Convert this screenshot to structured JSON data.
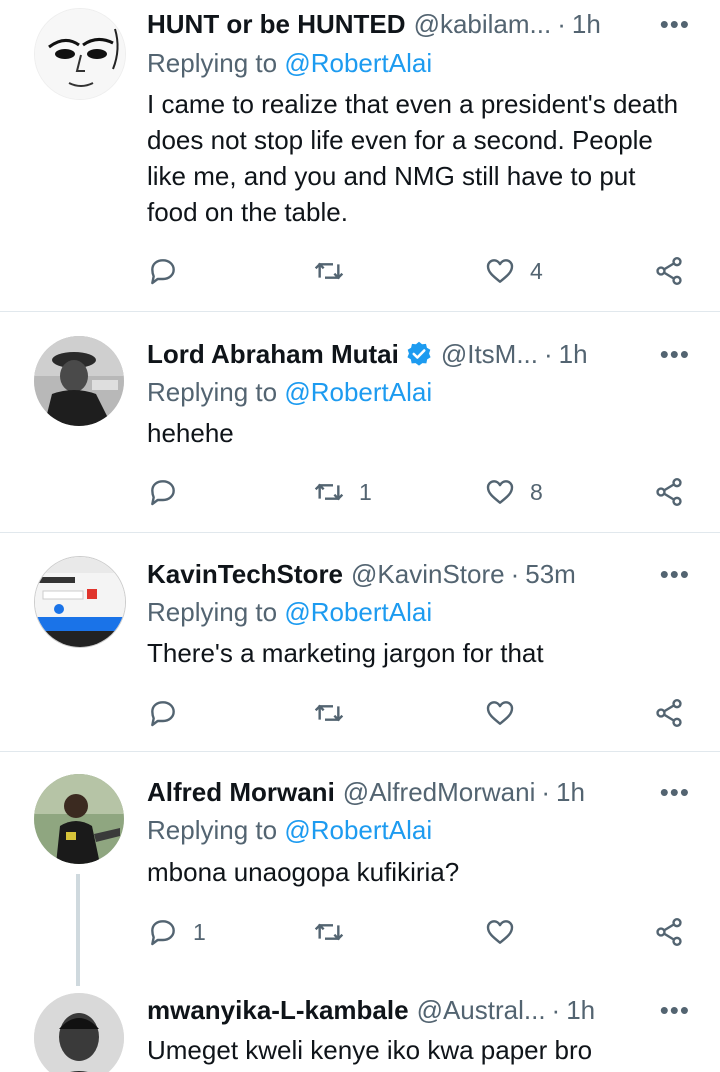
{
  "replying_label": "Replying to",
  "tweets": [
    {
      "name": "HUNT or be HUNTED",
      "handle": "@kabilam...",
      "time": "1h",
      "reply_to": "@RobertAlai",
      "text": "I came to realize that even a president's death does not stop life even for a second. People like me, and you and NMG still have to put food on the table.",
      "replies": "",
      "retweets": "",
      "likes": "4"
    },
    {
      "name": "Lord Abraham Mutai",
      "handle": "@ItsM...",
      "time": "1h",
      "verified": true,
      "reply_to": "@RobertAlai",
      "text": "hehehe",
      "replies": "",
      "retweets": "1",
      "likes": "8"
    },
    {
      "name": "KavinTechStore",
      "handle": "@KavinStore",
      "time": "53m",
      "reply_to": "@RobertAlai",
      "text": "There's a marketing jargon for that",
      "replies": "",
      "retweets": "",
      "likes": ""
    },
    {
      "name": "Alfred Morwani",
      "handle": "@AlfredMorwani",
      "time": "1h",
      "reply_to": "@RobertAlai",
      "text": "mbona unaogopa kufikiria?",
      "replies": "1",
      "retweets": "",
      "likes": ""
    },
    {
      "name": "mwanyika-L-kambale",
      "handle": "@Austral...",
      "time": "1h",
      "text": "Umeget kweli kenye iko kwa paper bro"
    }
  ],
  "icons": {
    "reply": "reply-icon",
    "retweet": "retweet-icon",
    "like": "heart-icon",
    "share": "share-icon",
    "more": "more-icon",
    "verified": "verified-badge-icon"
  },
  "colors": {
    "mention": "#1d9bf0",
    "secondary_text": "#536471",
    "verified": "#1d9bf0"
  }
}
